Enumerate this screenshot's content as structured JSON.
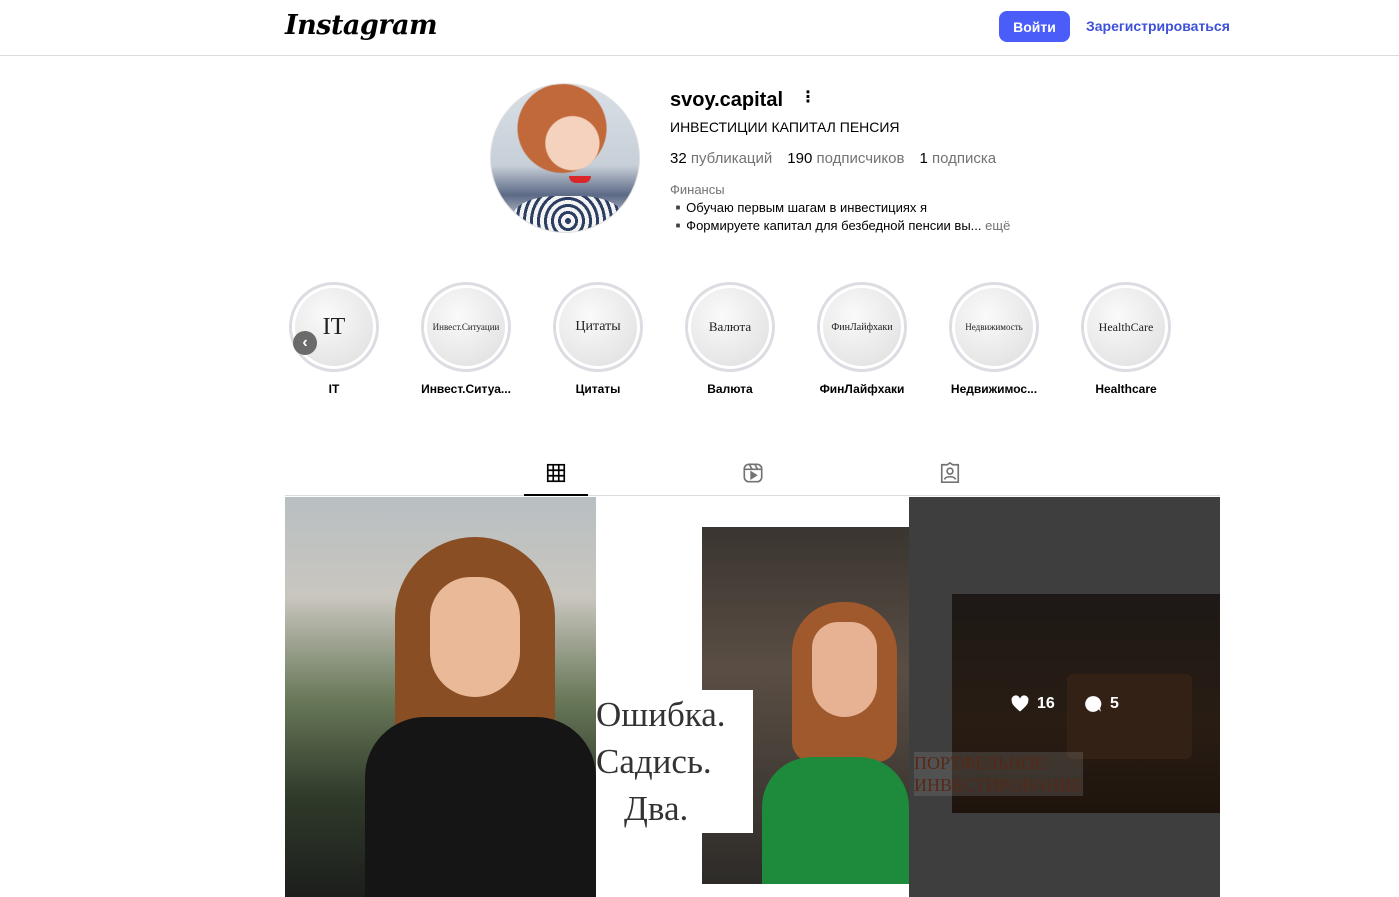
{
  "header": {
    "logo": "Instagram",
    "login_label": "Войти",
    "signup_label": "Зарегистрироваться"
  },
  "profile": {
    "username": "svoy.capital",
    "full_name": "ИНВЕСТИЦИИ КАПИТАЛ ПЕНСИЯ",
    "posts_count": "32",
    "posts_label": "публикаций",
    "followers_count": "190",
    "followers_label": "подписчиков",
    "following_count": "1",
    "following_label": "подписка",
    "category": "Финансы",
    "bio_line1": "▪️Обучаю первым шагам в инвестициях я",
    "bio_line2": "▪️Формируете капитал для безбедной пенсии вы...",
    "bio_more": "ещё"
  },
  "highlights": [
    {
      "cover": "IT",
      "label": "IT"
    },
    {
      "cover": "Инвест.Ситуации",
      "label": "Инвест.Ситуа..."
    },
    {
      "cover": "Цитаты",
      "label": "Цитаты"
    },
    {
      "cover": "Валюта",
      "label": "Валюта"
    },
    {
      "cover": "ФинЛайфхаки",
      "label": "ФинЛайфхаки"
    },
    {
      "cover": "Недвижимость",
      "label": "Недвижимос..."
    },
    {
      "cover": "HealthCare",
      "label": "Healthcare"
    }
  ],
  "tabs": [
    {
      "icon": "grid-icon",
      "active": true
    },
    {
      "icon": "reels-icon",
      "active": false
    },
    {
      "icon": "tagged-icon",
      "active": false
    }
  ],
  "posts": [
    {
      "type": "photo"
    },
    {
      "type": "photo-with-text",
      "text_lines": [
        "Ошибка.",
        "Садись.",
        "Два."
      ]
    },
    {
      "type": "photo-with-text",
      "caption_lines": [
        "ПОРТФЕЛЬНОЕ",
        "ИНВЕСТИРОВАНИЕ"
      ],
      "likes": "16",
      "comments": "5"
    }
  ]
}
